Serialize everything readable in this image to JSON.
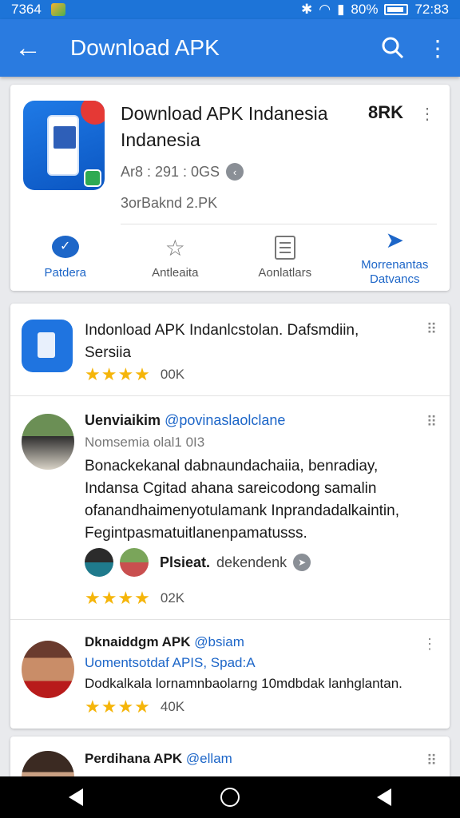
{
  "status_bar": {
    "time_left": "7364",
    "signal_text": "80%",
    "time_right": "72:83"
  },
  "app_bar": {
    "title": "Download APK",
    "back_icon": "arrow-back-icon",
    "search_icon": "search-icon",
    "menu_icon": "more-vert-icon"
  },
  "hero": {
    "name": "Download APK Indanesia Indanesia",
    "size": "8RK",
    "meta": "Ar8 : 291 : 0GS",
    "sub": "3orBaknd 2.PK",
    "actions": [
      {
        "label": "Patdera",
        "icon": "chat-icon"
      },
      {
        "label": "Antleaita",
        "icon": "star-outline-icon"
      },
      {
        "label": "Aonlatlars",
        "icon": "document-icon"
      },
      {
        "label": "Morrenantas Datvancs",
        "icon": "share-icon"
      }
    ]
  },
  "list": {
    "item1": {
      "title": "Indonload APK Indanlcstolan. Dafsmdiin, Sersiia",
      "stars": "★★★★",
      "count": "00K"
    },
    "item2": {
      "name": "Uenviaikim",
      "handle": "@povinaslaolclane",
      "sub": "Nomsemia olal1 0I3",
      "body": "Bonackekanal dabnaundachaiia, benradiay, Indansa Cgitad ahana sareicodong samalin ofanandhaimenyotulamank Inprandadalkaintin, Fegintpasmatuitlanenpamatusss.",
      "label": "Plsieat.",
      "label2": "dekendenk",
      "stars": "★★★★",
      "count": "02K"
    },
    "item3": {
      "name": "Dknaiddgm APK",
      "handle": "@bsiam",
      "sub": "Uomentsotdaf APIS, Spad:A",
      "body": "Dodkalkala lornamnbaolarng 10mdbdak lanhglantan.",
      "stars": "★★★★",
      "count": "40K"
    },
    "item4": {
      "name": "Perdihana APK",
      "handle": "@ellam"
    }
  }
}
